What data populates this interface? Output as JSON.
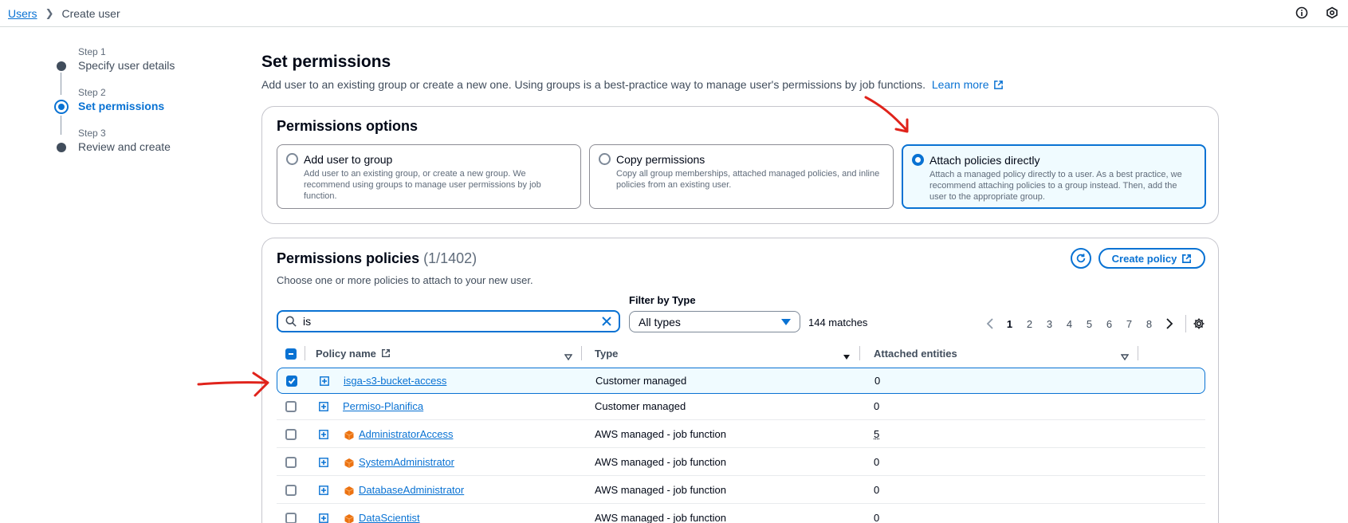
{
  "breadcrumb": {
    "root": "Users",
    "current": "Create user"
  },
  "steps": [
    {
      "label": "Step 1",
      "title": "Specify user details"
    },
    {
      "label": "Step 2",
      "title": "Set permissions"
    },
    {
      "label": "Step 3",
      "title": "Review and create"
    }
  ],
  "header": {
    "title": "Set permissions",
    "description": "Add user to an existing group or create a new one. Using groups is a best-practice way to manage user's permissions by job functions.",
    "learn_more": "Learn more"
  },
  "options": {
    "title": "Permissions options",
    "selected": "Attach policies directly",
    "tiles": [
      {
        "title": "Add user to group",
        "desc": "Add user to an existing group, or create a new group. We recommend using groups to manage user permissions by job function."
      },
      {
        "title": "Copy permissions",
        "desc": "Copy all group memberships, attached managed policies, and inline policies from an existing user."
      },
      {
        "title": "Attach policies directly",
        "desc": "Attach a managed policy directly to a user. As a best practice, we recommend attaching policies to a group instead. Then, add the user to the appropriate group."
      }
    ]
  },
  "policies": {
    "title": "Permissions policies",
    "count": "(1/1402)",
    "description": "Choose one or more policies to attach to your new user.",
    "create_label": "Create policy",
    "filter_label": "Filter by Type",
    "search_value": "is",
    "filter_value": "All types",
    "matches": "144 matches",
    "pages": [
      "1",
      "2",
      "3",
      "4",
      "5",
      "6",
      "7",
      "8"
    ],
    "current_page": "1",
    "columns": {
      "name": "Policy name",
      "type": "Type",
      "entities": "Attached entities"
    },
    "rows": [
      {
        "name": "isga-s3-bucket-access",
        "type": "Customer managed",
        "entities": "0",
        "checked": true,
        "aws": false
      },
      {
        "name": "Permiso-Planifica",
        "type": "Customer managed",
        "entities": "0",
        "checked": false,
        "aws": false
      },
      {
        "name": "AdministratorAccess",
        "type": "AWS managed - job function",
        "entities": "5",
        "checked": false,
        "aws": true
      },
      {
        "name": "SystemAdministrator",
        "type": "AWS managed - job function",
        "entities": "0",
        "checked": false,
        "aws": true
      },
      {
        "name": "DatabaseAdministrator",
        "type": "AWS managed - job function",
        "entities": "0",
        "checked": false,
        "aws": true
      },
      {
        "name": "DataScientist",
        "type": "AWS managed - job function",
        "entities": "0",
        "checked": false,
        "aws": true
      }
    ]
  },
  "colors": {
    "accent": "#0972d3",
    "selected_bg": "#f0fbff",
    "annotation": "#e0231b"
  },
  "icons": [
    "info-icon",
    "settings-hex-icon",
    "external-link-icon",
    "refresh-icon",
    "search-icon",
    "clear-icon",
    "expand-icon",
    "aws-managed-icon",
    "gear-icon"
  ]
}
